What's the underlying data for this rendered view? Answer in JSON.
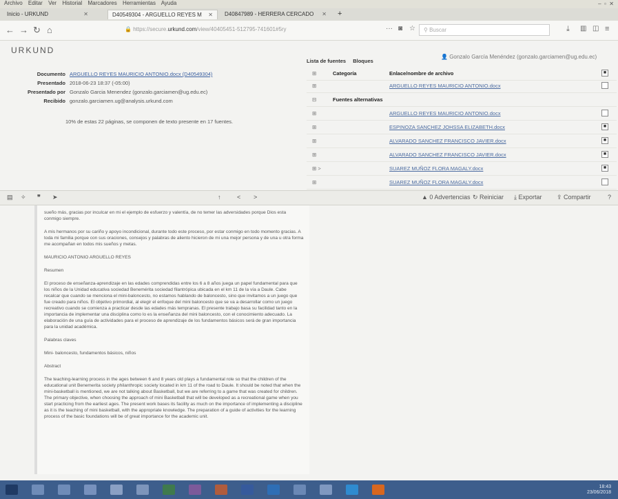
{
  "menu": [
    "Archivo",
    "Editar",
    "Ver",
    "Historial",
    "Marcadores",
    "Herramientas",
    "Ayuda"
  ],
  "tabs": [
    {
      "label": "Inicio - URKUND"
    },
    {
      "label": "D40549304 - ARGUELLO REYES M"
    },
    {
      "label": "D40847989 - HERRERA CERCADO"
    }
  ],
  "url": {
    "prefix": "https://secure.",
    "host": "urkund.com",
    "path": "/view/40405451-512795-741601#5ry"
  },
  "search_placeholder": "Buscar",
  "app": {
    "logo": "URKUND",
    "user": "Gonzalo García Menéndez (gonzalo.garciamen@ug.edu.ec)"
  },
  "doc_info": [
    {
      "key": "Documento",
      "value": "ARGUELLO REYES MAURICIO ANTONIO.docx (D40549304)",
      "link": true
    },
    {
      "key": "Presentado",
      "value": "2018-06-23 18:37 (-05:00)",
      "link": false
    },
    {
      "key": "Presentado por",
      "value": "Gonzalo Garcia Menendez (gonzalo.garciamen@ug.edu.ec)",
      "link": false
    },
    {
      "key": "Recibido",
      "value": "gonzalo.garciamen.ug@analysis.urkund.com",
      "link": false
    }
  ],
  "percent_line": "10%  de estas 22 páginas, se componen de texto presente en 17 fuentes.",
  "sources": {
    "tabs": [
      "Lista de fuentes",
      "Bloques"
    ],
    "header": {
      "category": "Categoría",
      "name": "Enlace/nombre de archivo"
    },
    "rows": [
      {
        "icon": "⊞",
        "category": "",
        "name": "ARGUELLO REYES MAURICIO ANTONIO.docx",
        "checked": false
      },
      {
        "icon": "⊟",
        "category": "Fuentes alternativas",
        "name": "",
        "checked": null
      },
      {
        "icon": "⊞",
        "category": "",
        "name": "ARGUELLO REYES MAURICIO ANTONIO.docx",
        "checked": false
      },
      {
        "icon": "⊞",
        "category": "",
        "name": "ESPINOZA SANCHEZ JOHSSA ELIZABETH.docx",
        "checked": true
      },
      {
        "icon": "⊞",
        "category": "",
        "name": "ALVARADO SANCHEZ FRANCISCO JAVIER.docx",
        "checked": true
      },
      {
        "icon": "⊞",
        "category": "",
        "name": "ALVARADO SANCHEZ FRANCISCO JAVIER.docx",
        "checked": true
      },
      {
        "icon": "⊞ >",
        "category": "",
        "name": "SUAREZ MUÑOZ FLORA MAGALY.docx",
        "checked": true
      },
      {
        "icon": "⊞",
        "category": "",
        "name": "SUAREZ MUÑOZ FLORA MAGALY.docx",
        "checked": false
      }
    ]
  },
  "viewer_toolbar": {
    "warnings": "0 Advertencias",
    "reset": "Reiniciar",
    "export": "Exportar",
    "share": "Compartir"
  },
  "document": [
    "sueño más, gracias por inculcar en mi el ejemplo de esfuerzo y valentía, de no temer las adversidades porque Dios esta conmigo siempre.",
    "A mis hermanos por su cariño y apoyo incondicional, durante todo este proceso, por estar conmigo en todo momento gracias. A toda mi familia porque con sus oraciones, consejos y palabras de aliento hicieron de mi una mejor persona y de una u otra forma me acompañan en todos mis sueños y metas.",
    "MAURICIO ANTONIO ARGUELLO REYES",
    "Resumen",
    "El proceso de enseñanza-aprendizaje en las edades comprendidas entre los 6 a 8 años juega un papel fundamental para que los niños de la Unidad educativa sociedad Benemérita sociedad filantrópica ubicada en el km 11 de la vía a Daule. Cabe recalcar que cuando se menciona el mini-baloncesto, no estamos hablando de baloncesto, sino que invitamos a un juego que fue creado para niños. El objetivo primordial, al elegir el enfoque del mini baloncesto que se va a desarrollar como un juego recreativo cuando se comienza a practicar desde las edades más tempranas. El presente trabajo basa su facilidad tanto en la importancia de implementar una disciplina como lo es la enseñanza del mini baloncesto, con el conocimiento adecuado. La elaboración de una guía de actividades para el proceso de aprendizaje de los fundamentos básicos será de gran importancia para la unidad académica.",
    "Palabras claves",
    "Mini- baloncesto, fundamentos básicos, niños",
    "Abstract",
    "The teaching-learning process in the ages between 6 and 8 years old plays a fundamental role so that the children of the educational unit Benemerita society philanthropic society located in km 11 of the road to Daule. It should be noted that when the mini-basketball is mentioned, we are not talking about Basketball, but we are referring to a game that was created for children. The primary objective, when choosing the approach of mini Basketball that will be developed as a recreational game when you start practicing from the earliest ages. The present work bases its facility as much on the importance of implementing a discipline as it is the teaching of mini basketball, with the appropriate knowledge. The preparation of a guide of activities for the learning process of the basic foundations will be of great importance for the academic unit."
  ],
  "clock": {
    "time": "18:43",
    "date": "23/06/2018"
  }
}
